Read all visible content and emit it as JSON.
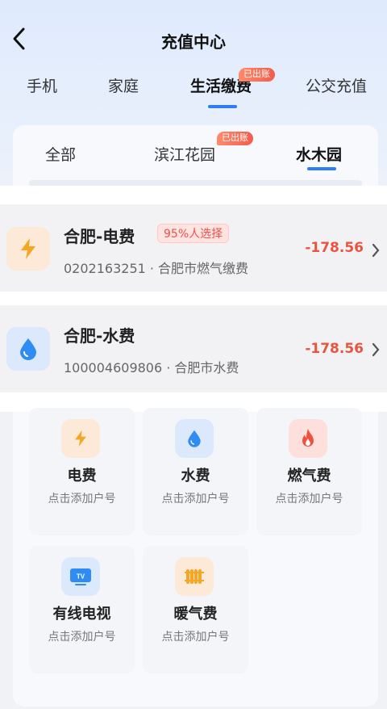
{
  "header": {
    "title": "充值中心",
    "back_icon": "chevron-left-icon"
  },
  "main_tabs": [
    {
      "label": "手机"
    },
    {
      "label": "家庭"
    },
    {
      "label": "生活缴费",
      "active": true,
      "badge": "已出账"
    },
    {
      "label": "公交充值"
    }
  ],
  "sub_tabs": [
    {
      "label": "全部"
    },
    {
      "label": "滨江花园",
      "badge": "已出账"
    },
    {
      "label": "水木园",
      "active": true
    }
  ],
  "bills": [
    {
      "title": "合肥-电费",
      "badge": "95%人选择",
      "account": "0202163251 · 合肥市燃气缴费",
      "amount": "-178.56",
      "icon": "lightning-icon",
      "accent": "#f5a623"
    },
    {
      "title": "合肥-水费",
      "account": "100004609806 · 合肥市水费",
      "amount": "-178.56",
      "icon": "water-drop-icon",
      "accent": "#2f8cf3"
    }
  ],
  "services": [
    {
      "name": "电费",
      "hint": "点击添加户号",
      "icon": "lightning-icon"
    },
    {
      "name": "水费",
      "hint": "点击添加户号",
      "icon": "water-drop-icon"
    },
    {
      "name": "燃气费",
      "hint": "点击添加户号",
      "icon": "flame-icon"
    },
    {
      "name": "有线电视",
      "hint": "点击添加户号",
      "icon": "tv-icon",
      "icon_text": "TV"
    },
    {
      "name": "暖气费",
      "hint": "点击添加户号",
      "icon": "radiator-icon"
    }
  ],
  "colors": {
    "accent_blue": "#2f7cf6",
    "amount_red": "#e8553f",
    "badge_orange": "#f35b4c"
  }
}
